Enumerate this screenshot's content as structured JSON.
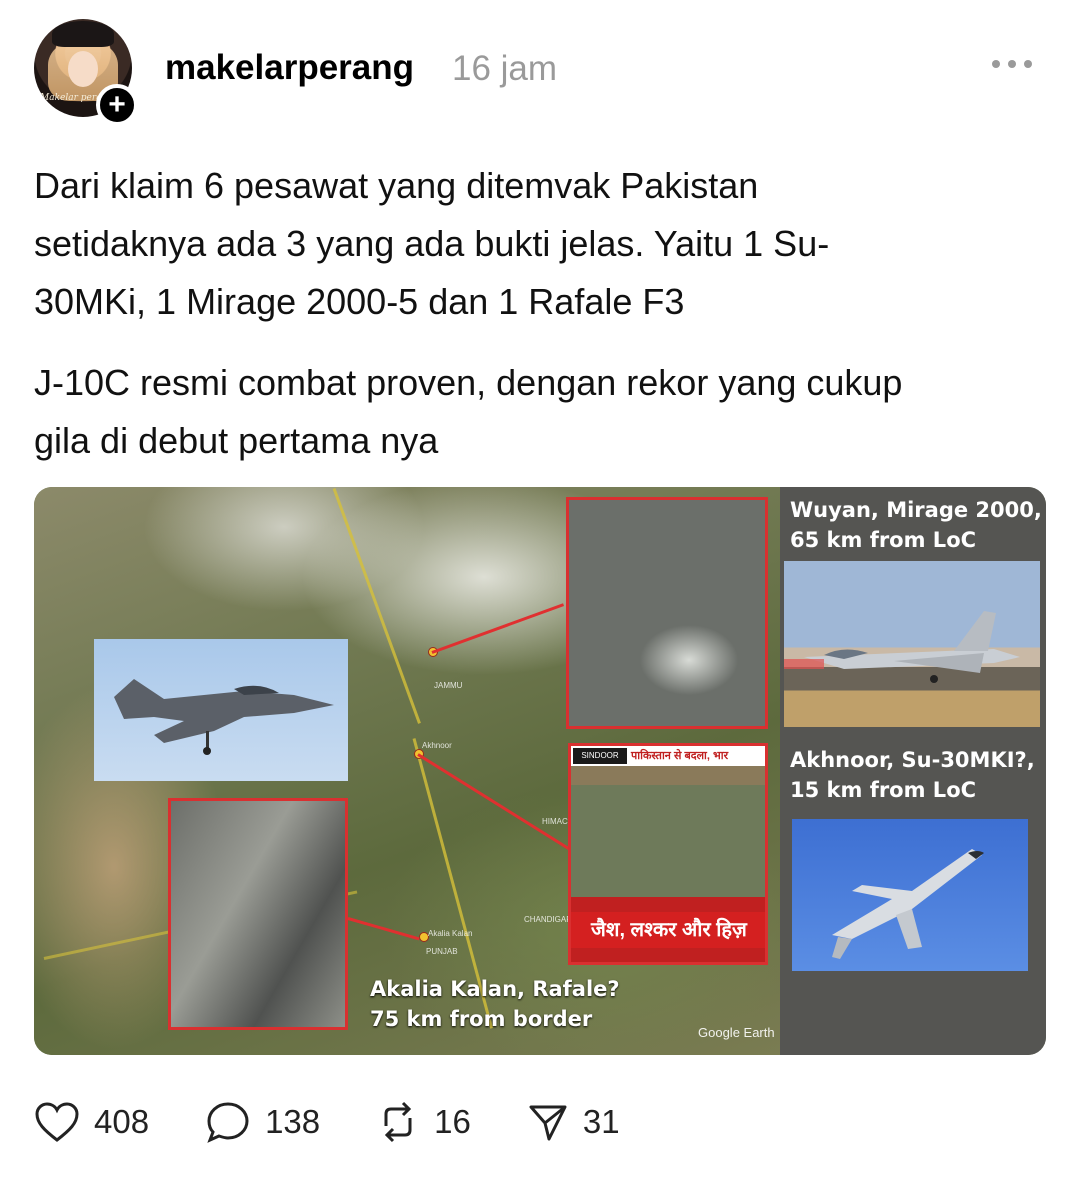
{
  "post": {
    "username": "makelarperang",
    "time": "16 jam",
    "avatar_caption": "Makelar perang",
    "paragraph1": "Dari klaim 6 pesawat yang ditemvak Pakistan setidaknya ada 3 yang ada bukti jelas. Yaitu 1 Su-30MKi, 1 Mirage 2000-5 dan 1 Rafale F3",
    "paragraph2": "J-10C resmi combat proven, dengan rekor yang cukup gila di debut pertama nya"
  },
  "image": {
    "caption_akalia_line1": "Akalia Kalan, Rafale?",
    "caption_akalia_line2": "75 km from border",
    "caption_wuyan_line1": "Wuyan, Mirage 2000,",
    "caption_wuyan_line2": "65 km from LoC",
    "caption_akhnoor_line1": "Akhnoor, Su-30MKI?,",
    "caption_akhnoor_line2": "15 km from LoC",
    "news_badge": "SINDOOR",
    "news_ticker": "पाकिस्तान से बदला, भार",
    "news_bottom": "जैश, लश्कर और हिज़",
    "map_labels": [
      "Akhnoor",
      "Akalia Kalan",
      "PUNJAB",
      "CHANDIGAR",
      "HIMACHAL P",
      "JAMMU"
    ],
    "google_earth": "Google Earth"
  },
  "actions": {
    "likes": "408",
    "comments": "138",
    "reposts": "16",
    "shares": "31"
  },
  "icons": [
    "heart-icon",
    "comment-icon",
    "repost-icon",
    "share-icon",
    "more-icon",
    "plus-icon"
  ]
}
